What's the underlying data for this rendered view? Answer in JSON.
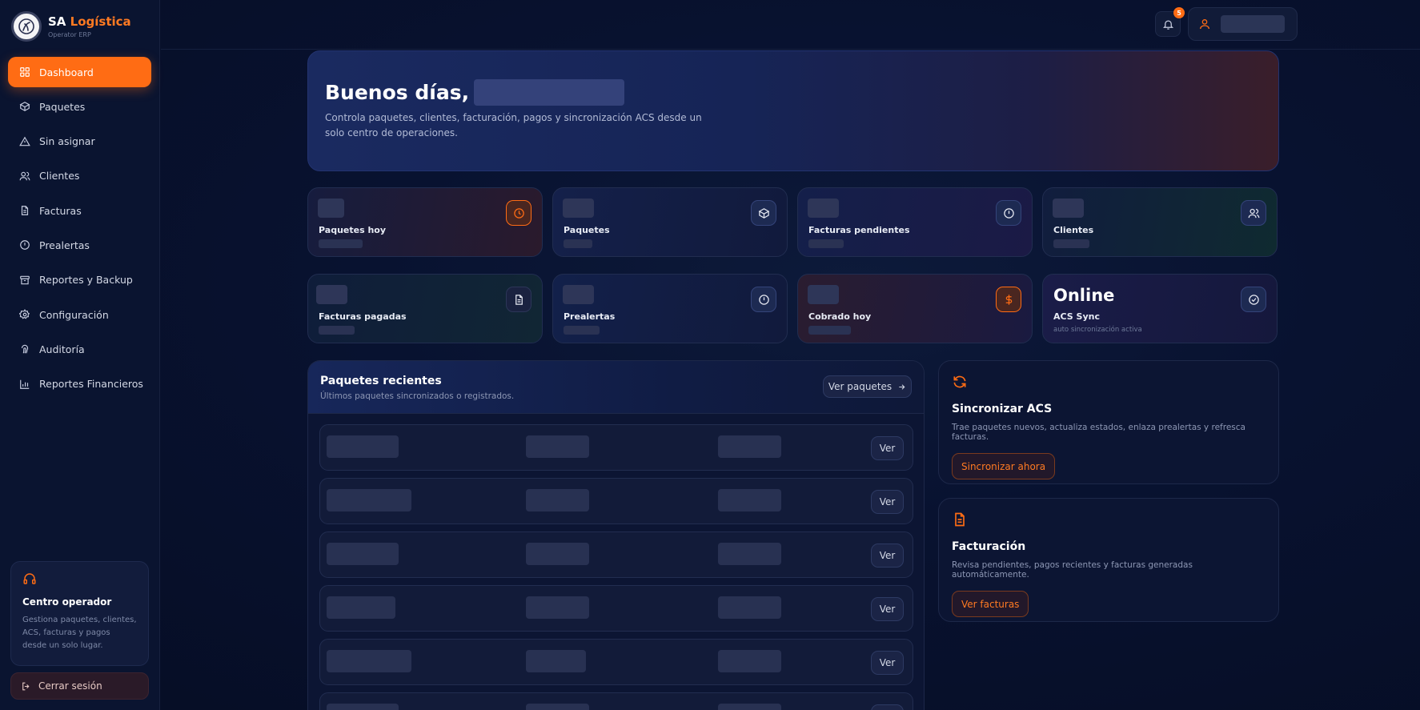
{
  "brand": {
    "name_prefix": "SA",
    "name_accent": "Logística",
    "subtitle": "Operator ERP"
  },
  "nav": [
    {
      "label": "Dashboard",
      "icon": "grid-icon",
      "active": true
    },
    {
      "label": "Paquetes",
      "icon": "box-icon"
    },
    {
      "label": "Sin asignar",
      "icon": "alert-triangle-icon"
    },
    {
      "label": "Clientes",
      "icon": "users-icon"
    },
    {
      "label": "Facturas",
      "icon": "file-icon"
    },
    {
      "label": "Prealertas",
      "icon": "alert-circle-icon"
    },
    {
      "label": "Reportes y Backup",
      "icon": "archive-icon"
    },
    {
      "label": "Configuración",
      "icon": "gear-icon"
    },
    {
      "label": "Auditoría",
      "icon": "fingerprint-icon"
    },
    {
      "label": "Reportes Financieros",
      "icon": "bar-chart-icon"
    }
  ],
  "operator_card": {
    "title": "Centro operador",
    "description": "Gestiona paquetes, clientes, ACS, facturas y pagos desde un solo lugar."
  },
  "logout_label": "Cerrar sesión",
  "topbar": {
    "notification_count": "5"
  },
  "hero": {
    "greeting": "Buenos días,",
    "description": "Controla paquetes, clientes, facturación, pagos y sincronización ACS desde un solo centro de operaciones."
  },
  "stats": [
    {
      "label": "Paquetes hoy",
      "icon": "clock-icon",
      "accent": "#ff6c14"
    },
    {
      "label": "Paquetes",
      "icon": "box-icon"
    },
    {
      "label": "Facturas pendientes",
      "icon": "alert-circle-icon"
    },
    {
      "label": "Clientes",
      "icon": "users-icon"
    },
    {
      "label": "Facturas pagadas",
      "icon": "file-icon"
    },
    {
      "label": "Prealertas",
      "icon": "alert-circle-icon"
    },
    {
      "label": "Cobrado hoy",
      "icon": "dollar-icon",
      "accent": "#ff6c14"
    },
    {
      "label": "ACS Sync",
      "value": "Online",
      "sub": "auto sincronización activa",
      "icon": "check-circle-icon"
    }
  ],
  "recent": {
    "title": "Paquetes recientes",
    "subtitle": "Últimos paquetes sincronizados o registrados.",
    "view_all_label": "Ver paquetes",
    "row_action_label": "Ver",
    "row_count": 6
  },
  "sync_card": {
    "title": "Sincronizar ACS",
    "description": "Trae paquetes nuevos, actualiza estados, enlaza prealertas y refresca facturas.",
    "button": "Sincronizar ahora"
  },
  "billing_card": {
    "title": "Facturación",
    "description": "Revisa pendientes, pagos recientes y facturas generadas automáticamente.",
    "button": "Ver facturas"
  },
  "colors": {
    "accent": "#ff6c14",
    "background": "#081230",
    "panel": "#0c1533"
  }
}
